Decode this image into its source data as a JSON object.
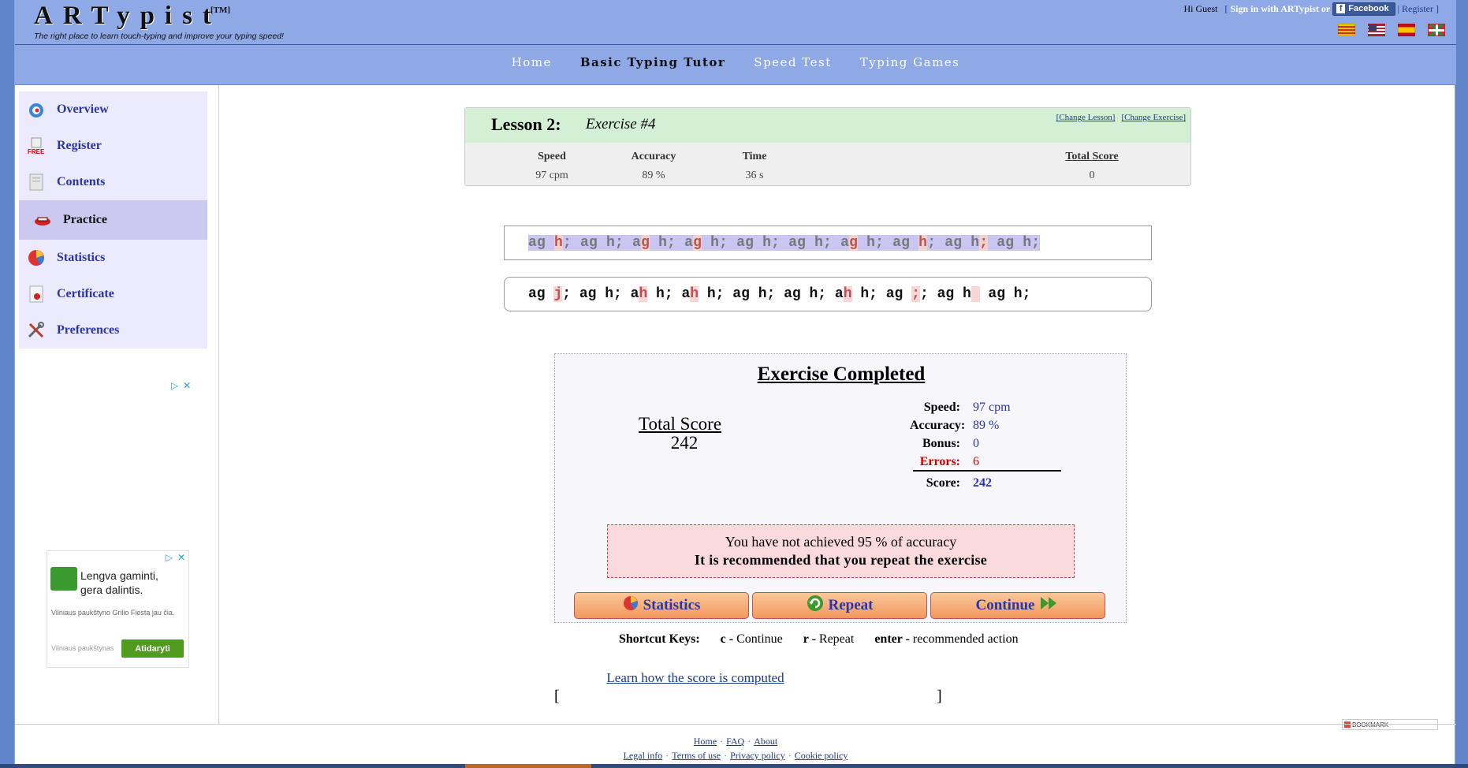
{
  "header": {
    "logo": "ARTypist",
    "logo_tm": "[TM]",
    "tagline": "The right place to learn touch-typing and improve your typing speed!",
    "greeting": "Hi",
    "user": "Guest",
    "signin_text": "Sign in with ARTypist",
    "or_text": "or",
    "facebook_label": "Facebook",
    "register_label": "Register",
    "flags": [
      "catalan-flag",
      "usa-flag",
      "spain-flag",
      "basque-flag"
    ]
  },
  "nav": {
    "items": [
      {
        "label": "Home",
        "active": false
      },
      {
        "label": "Basic Typing Tutor",
        "active": true
      },
      {
        "label": "Speed Test",
        "active": false
      },
      {
        "label": "Typing Games",
        "active": false
      }
    ]
  },
  "sidebar": {
    "items": [
      {
        "label": "Overview",
        "icon": "overview-icon"
      },
      {
        "label": "Register",
        "icon": "free-register-icon"
      },
      {
        "label": "Contents",
        "icon": "contents-icon"
      },
      {
        "label": "Practice",
        "icon": "keyboard-icon",
        "active": true
      },
      {
        "label": "Statistics",
        "icon": "statistics-icon"
      },
      {
        "label": "Certificate",
        "icon": "certificate-icon"
      },
      {
        "label": "Preferences",
        "icon": "tools-icon"
      }
    ]
  },
  "ad": {
    "title_line1": "Lengva gaminti,",
    "title_line2": "gera dalintis.",
    "desc": "Vilniaus paukštyno Grilio Fiesta jau čia.",
    "source": "Vilniaus paukštynas",
    "cta": "Atidaryti",
    "adchoice": "▷",
    "close": "✕"
  },
  "lesson": {
    "title": "Lesson 2:",
    "exercise": "Exercise #4",
    "change_lesson": "[Change Lesson]",
    "change_exercise": "[Change Exercise]",
    "stats": [
      {
        "label": "Speed",
        "value": "97 cpm"
      },
      {
        "label": "Accuracy",
        "value": "89 %"
      },
      {
        "label": "Time",
        "value": "36 s"
      },
      {
        "label": "Total Score",
        "value": "0"
      }
    ]
  },
  "typing": {
    "target_segments": [
      {
        "t": "ag ",
        "err": false
      },
      {
        "t": "h",
        "err": true
      },
      {
        "t": "; ag h; a",
        "err": false
      },
      {
        "t": "g",
        "err": true
      },
      {
        "t": " h; a",
        "err": false
      },
      {
        "t": "g",
        "err": true
      },
      {
        "t": " h; ag h; ag h; a",
        "err": false
      },
      {
        "t": "g",
        "err": true
      },
      {
        "t": " h; ag ",
        "err": false
      },
      {
        "t": "h",
        "err": true
      },
      {
        "t": "; ag h",
        "err": false
      },
      {
        "t": ";",
        "err": true
      },
      {
        "t": " ag h;",
        "err": false
      }
    ],
    "typed_segments": [
      {
        "t": "ag ",
        "err": false
      },
      {
        "t": "j",
        "err": true
      },
      {
        "t": "; ag h; a",
        "err": false
      },
      {
        "t": "h",
        "err": true
      },
      {
        "t": " h; a",
        "err": false
      },
      {
        "t": "h",
        "err": true
      },
      {
        "t": " h; ag h; ag h; a",
        "err": false
      },
      {
        "t": "h",
        "err": true
      },
      {
        "t": " h; ag ",
        "err": false
      },
      {
        "t": ";",
        "err": true
      },
      {
        "t": "; ag h",
        "err": false
      },
      {
        "t": " ",
        "err": true
      },
      {
        "t": " ag h;",
        "err": false
      }
    ]
  },
  "result": {
    "title": "Exercise Completed",
    "total_score_label": "Total Score",
    "total_score_value": "242",
    "rows": [
      {
        "k": "Speed:",
        "v": "97 cpm"
      },
      {
        "k": "Accuracy:",
        "v": "89 %"
      },
      {
        "k": "Bonus:",
        "v": "0"
      },
      {
        "k": "Errors:",
        "v": "6",
        "error": true
      }
    ],
    "score_label": "Score:",
    "score_value": "242",
    "warning_line1": "You have not achieved 95 % of accuracy",
    "warning_line2": "It is recommended that you repeat the exercise",
    "buttons": {
      "statistics": "Statistics",
      "repeat": "Repeat",
      "continue": "Continue"
    }
  },
  "shortcuts": {
    "label": "Shortcut Keys:",
    "c_key": "c -",
    "c_desc": "Continue",
    "r_key": "r -",
    "r_desc": "Repeat",
    "enter_key": "enter -",
    "enter_desc": "recommended action"
  },
  "score_link": "Learn how the score is computed",
  "brackets": {
    "left": "[",
    "right": "]"
  },
  "bookmark_label": "BOOKMARK",
  "footer": {
    "row1": [
      "Home",
      "FAQ",
      "About"
    ],
    "row2": [
      "Legal info",
      "Terms of use",
      "Privacy policy",
      "Cookie policy"
    ],
    "sep": "·"
  },
  "colors": {
    "header": "#8fa9e6",
    "link": "#2b35a8",
    "error": "#cc0000",
    "lesson_head": "#d4f0d4",
    "button": "#f2975c"
  }
}
